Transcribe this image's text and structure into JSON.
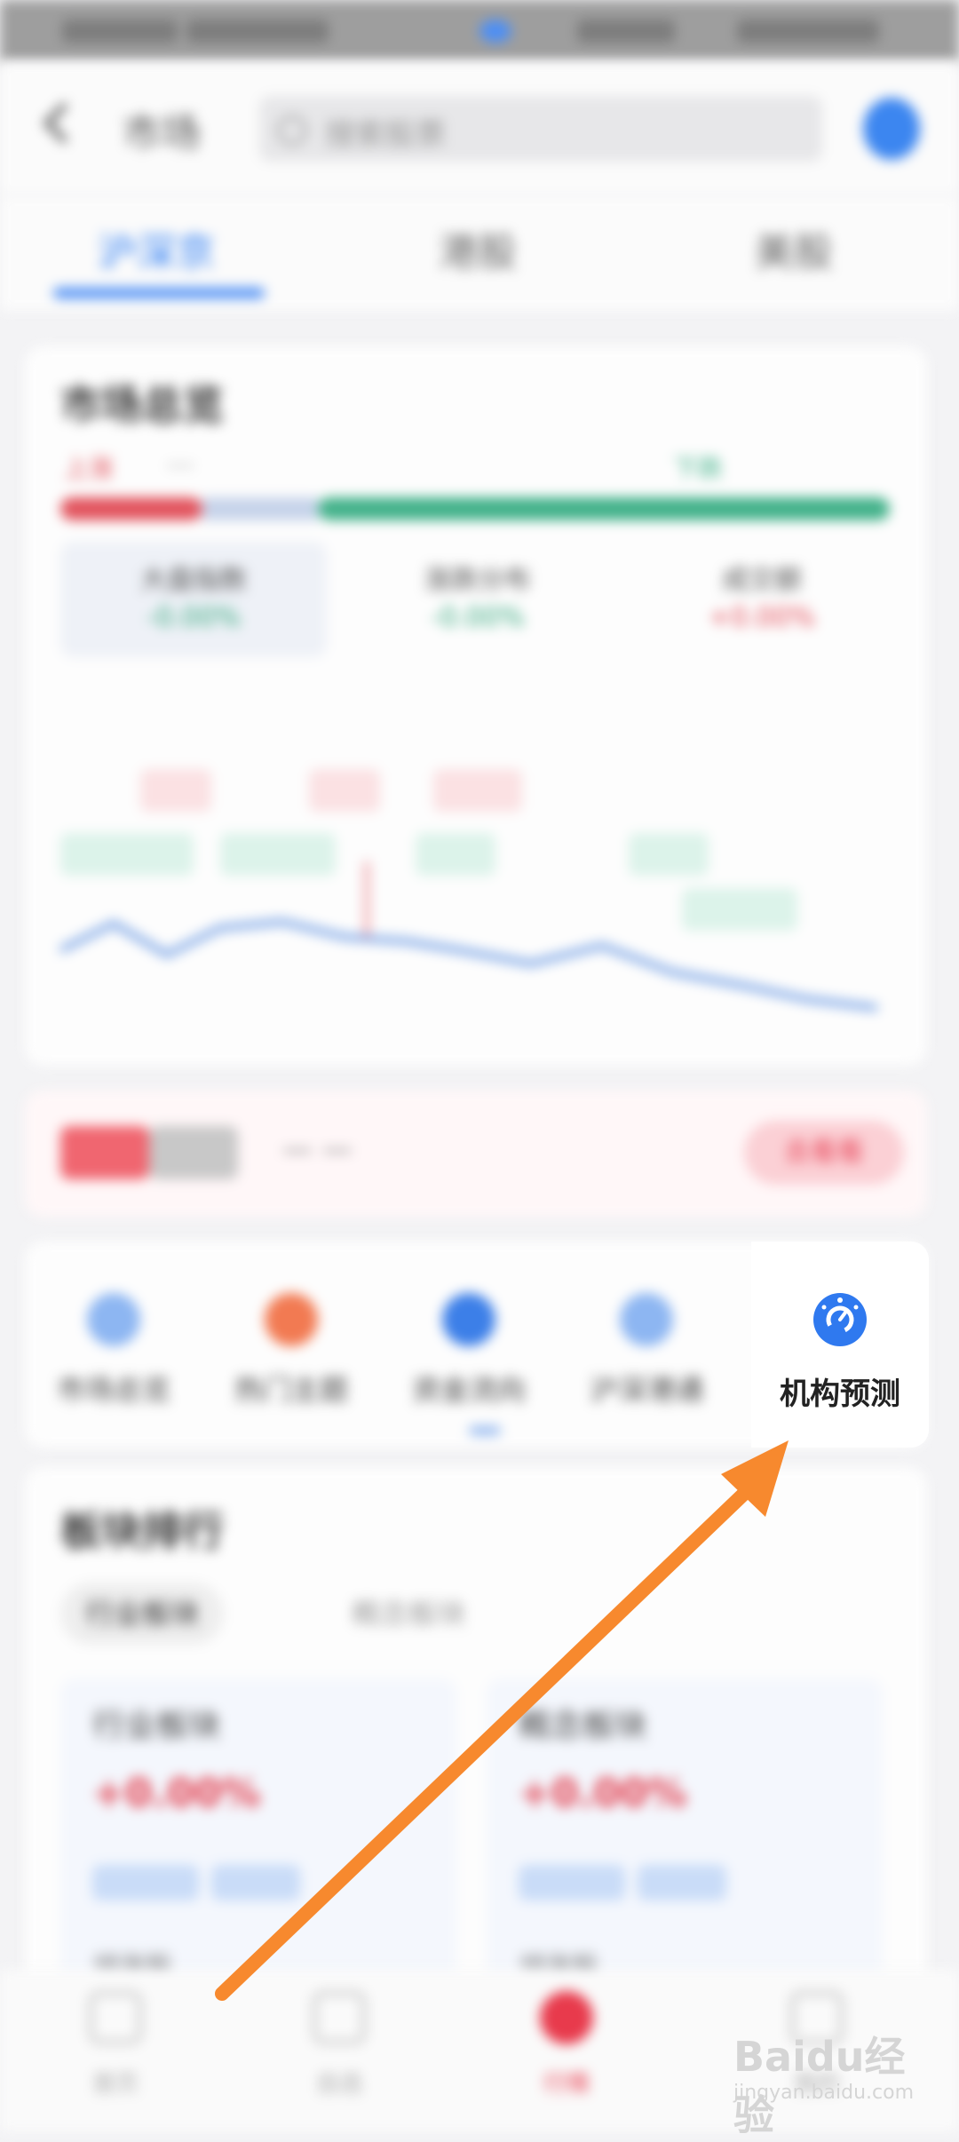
{
  "status_bar": {},
  "header": {
    "title": "市场",
    "search_placeholder": "搜索股票",
    "back_icon": "chevron-left-icon",
    "avatar_icon": "user-avatar-icon"
  },
  "tabs": [
    {
      "label": "沪深京",
      "active": true
    },
    {
      "label": "港股",
      "active": false
    },
    {
      "label": "美股",
      "active": false
    }
  ],
  "market_overview": {
    "title": "市场总览",
    "rise_label": "上涨",
    "fall_label": "下跌",
    "stats": [
      {
        "title": "大盘指数",
        "value": "-0.00%"
      },
      {
        "title": "涨跌分布",
        "value": "-0.00%"
      },
      {
        "title": "成交额",
        "value": "+0.00%"
      }
    ],
    "chart_colors": {
      "line": "#5b8fe0",
      "up": "#e24955",
      "down": "#32a57a"
    }
  },
  "ticker": {
    "button_label": "去看看"
  },
  "quick_menu": {
    "items": [
      {
        "label": "市场总览",
        "icon": "globe-icon",
        "color": "#8db6f2"
      },
      {
        "label": "热门主题",
        "icon": "fire-icon",
        "color": "#f27a52"
      },
      {
        "label": "资金流向",
        "icon": "chat-icon",
        "color": "#3c7fe8"
      },
      {
        "label": "沪深港通",
        "icon": "copy-icon",
        "color": "#8db6f2"
      }
    ],
    "focused_item": {
      "label": "机构预测",
      "icon": "gauge-icon",
      "color": "#2f79ef"
    }
  },
  "sector_section": {
    "title": "板块排行",
    "pills": [
      "行业板块",
      "概念板块"
    ],
    "cards": [
      {
        "name": "行业板块",
        "percent": "+0.00%",
        "row": "领涨股"
      },
      {
        "name": "概念板块",
        "percent": "+0.00%",
        "row": "领涨股"
      }
    ]
  },
  "bottom_nav": [
    {
      "label": "首页",
      "icon": "home-icon",
      "active": false
    },
    {
      "label": "自选",
      "icon": "star-icon",
      "active": false
    },
    {
      "label": "行情",
      "icon": "chart-icon",
      "active": true
    },
    {
      "label": "我的",
      "icon": "user-icon",
      "active": false
    }
  ],
  "annotation": {
    "arrow_color": "#f7892e"
  },
  "watermark": {
    "brand": "Baidu经验",
    "url": "jingyan.baidu.com"
  }
}
